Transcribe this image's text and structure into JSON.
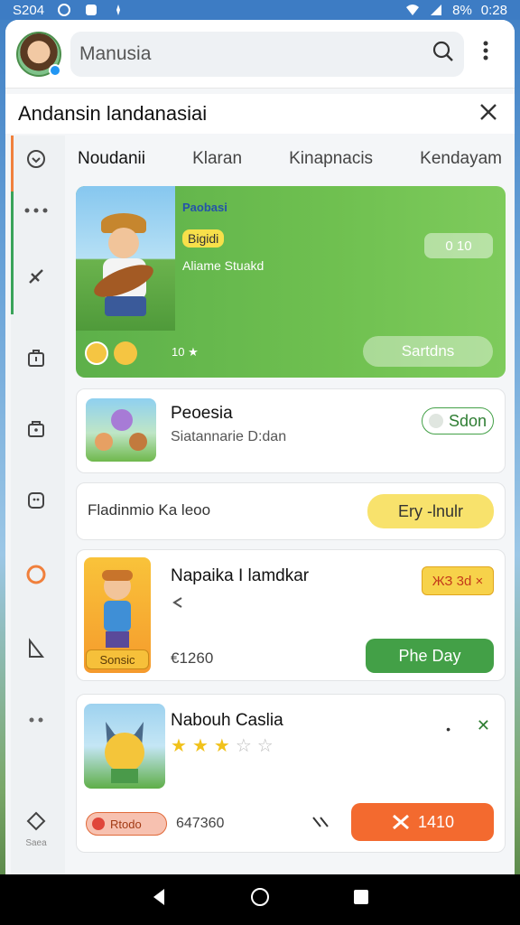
{
  "status_bar": {
    "time_left": "S204",
    "battery": "8%",
    "time_right": "0:28"
  },
  "search": {
    "value": "Manusia"
  },
  "header": {
    "title": "Andansin landanasiai"
  },
  "tabs": [
    "Noudanii",
    "Klaran",
    "Kinapnacis",
    "Kendayam"
  ],
  "rail": {
    "bottom_label": "Saea"
  },
  "hero": {
    "tag1": "Paobasi",
    "tag2": "Bigidi",
    "subtitle": "Aliame Stuakd",
    "timer": "0 10",
    "rating": "10 ★",
    "button": "Sartdns"
  },
  "items": [
    {
      "title": "Peoesia",
      "subtitle": "Siatannarie D:dan",
      "button": "Sdon"
    },
    {
      "title": "Fladinmio Ka leoo",
      "button": "Ery -lnulr"
    },
    {
      "title": "Napaika I lamdkar",
      "badge": "Sonsic",
      "price": "€1260",
      "tag": "ЖЗ 3d ×",
      "button": "Phe Day"
    },
    {
      "title": "Nabouh Caslia",
      "rating": 3,
      "max_rating": 5,
      "chip": "Rtodo",
      "price": "647360",
      "action_label": "1410"
    }
  ],
  "colors": {
    "accent_green": "#43a047",
    "accent_orange": "#f36a2f",
    "accent_yellow": "#f8e26c"
  }
}
